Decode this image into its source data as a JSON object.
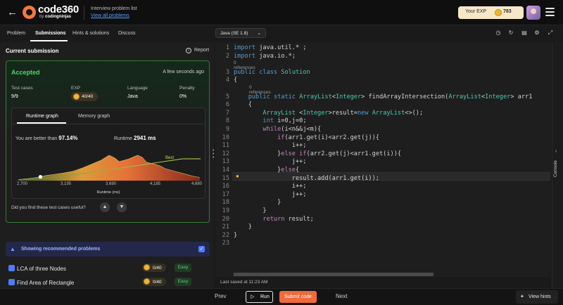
{
  "header": {
    "logo_text": "code360",
    "logo_sub_prefix": "by",
    "logo_sub_brand": "codingninjas",
    "crumb_top": "Interview problem list",
    "crumb_link": "View all problems",
    "exp_label": "Your EXP",
    "exp_value": "783"
  },
  "tabs": [
    "Problem",
    "Submissions",
    "Hints & solutions",
    "Discuss"
  ],
  "submission": {
    "title": "Current submission",
    "report": "Report",
    "status": "Accepted",
    "time_ago": "A few seconds ago",
    "stats": [
      {
        "label": "Test cases",
        "value": "9/9"
      },
      {
        "label": "EXP",
        "value": "40/40"
      },
      {
        "label": "Language",
        "value": "Java"
      },
      {
        "label": "Penalty",
        "value": "0%"
      }
    ],
    "graph_tabs": [
      "Runtime graph",
      "Memory graph"
    ],
    "better_prefix": "You are better than",
    "better_value": "97.14%",
    "runtime_prefix": "Runtime",
    "runtime_value": "2941 ms",
    "best_label": "Best",
    "useful": "Did you find these test cases useful?"
  },
  "chart_data": {
    "type": "area",
    "x_ticks": [
      "2,700",
      "3,195",
      "3,690",
      "4,185",
      "4,680"
    ],
    "xlabel": "Runtime (ms)",
    "xlim": [
      2700,
      4680
    ],
    "ylim": [
      0,
      1
    ],
    "marker_x": 2941,
    "x": [
      2700,
      2800,
      2900,
      2941,
      3000,
      3100,
      3195,
      3300,
      3400,
      3500,
      3600,
      3690,
      3750,
      3800,
      3900,
      4000,
      4050,
      4100,
      4185,
      4250,
      4300,
      4400,
      4500,
      4600,
      4680
    ],
    "values": [
      0.03,
      0.06,
      0.1,
      0.12,
      0.16,
      0.2,
      0.24,
      0.3,
      0.4,
      0.52,
      0.64,
      0.8,
      0.72,
      0.6,
      0.68,
      0.8,
      0.74,
      0.58,
      0.52,
      0.46,
      0.38,
      0.3,
      0.22,
      0.14,
      0.1
    ]
  },
  "recommended": {
    "label": "Showing recommended problems",
    "problems": [
      {
        "name": "LCA of three Nodes",
        "exp": "0/40",
        "difficulty": "Easy"
      },
      {
        "name": "Find Area of Rectangle",
        "exp": "0/40",
        "difficulty": "Easy"
      }
    ]
  },
  "editor": {
    "language": "Java (SE 1.8)",
    "references_label": "0 references",
    "lines": [
      {
        "n": "1",
        "text": "import java.util.* ;"
      },
      {
        "n": "2",
        "text": "import java.io.*;"
      },
      {
        "n": "3",
        "text": "public class Solution"
      },
      {
        "n": "4",
        "text": "{"
      },
      {
        "n": "5",
        "text": "    public static ArrayList<Integer> findArrayIntersection(ArrayList<Integer> arr1"
      },
      {
        "n": "6",
        "text": "    {"
      },
      {
        "n": "7",
        "text": "        ArrayList <Integer>result=new ArrayList<>();"
      },
      {
        "n": "8",
        "text": "        int i=0,j=0;"
      },
      {
        "n": "9",
        "text": "        while(i<n&&j<m){"
      },
      {
        "n": "10",
        "text": "            if(arr1.get(i)<arr2.get(j)){"
      },
      {
        "n": "11",
        "text": "                i++;"
      },
      {
        "n": "12",
        "text": "            }else if(arr2.get(j)<arr1.get(i)){"
      },
      {
        "n": "13",
        "text": "                j++;"
      },
      {
        "n": "14",
        "text": "            }else{"
      },
      {
        "n": "15",
        "text": "                result.add(arr1.get(i));"
      },
      {
        "n": "16",
        "text": "                i++;"
      },
      {
        "n": "17",
        "text": "                j++;"
      },
      {
        "n": "18",
        "text": "            }"
      },
      {
        "n": "19",
        "text": "        }"
      },
      {
        "n": "20",
        "text": "        return result;"
      },
      {
        "n": "21",
        "text": "    }"
      },
      {
        "n": "22",
        "text": "}"
      },
      {
        "n": "23",
        "text": ""
      }
    ],
    "last_saved": "Last saved at 11:23 AM",
    "console": "Console"
  },
  "bottom": {
    "prev": "Prev",
    "run": "Run",
    "submit": "Submit code",
    "next": "Next",
    "hints": "View hints"
  },
  "colors": {
    "accent": "#f06a3a",
    "success": "#4cd964",
    "link": "#5b9bff"
  }
}
